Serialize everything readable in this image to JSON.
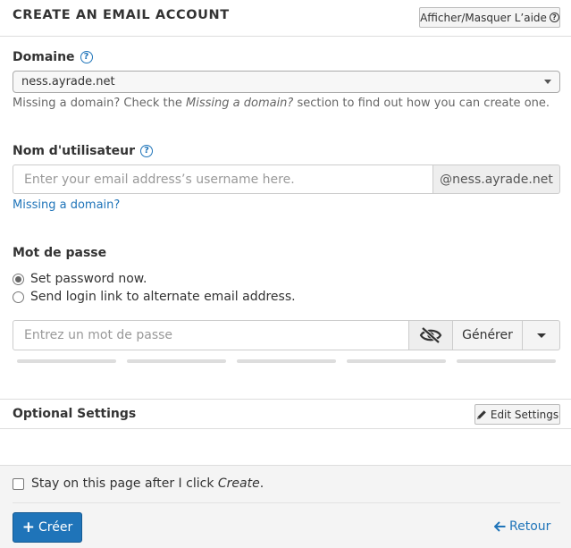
{
  "header": {
    "title": "CREATE AN EMAIL ACCOUNT",
    "help_toggle_label": "Afficher/Masquer L’aide",
    "help_icon": "?"
  },
  "domain": {
    "label": "Domaine",
    "help_icon": "?",
    "selected": "ness.ayrade.net",
    "hint_prefix": "Missing a domain? Check the ",
    "hint_emphasis": "Missing a domain?",
    "hint_suffix": " section to find out how you can create one."
  },
  "username": {
    "label": "Nom d'utilisateur",
    "help_icon": "?",
    "placeholder": "Enter your email address’s username here.",
    "domain_suffix": "@ness.ayrade.net",
    "missing_link": "Missing a domain?"
  },
  "password": {
    "label": "Mot de passe",
    "options": [
      {
        "label": "Set password now.",
        "checked": true
      },
      {
        "label": "Send login link to alternate email address.",
        "checked": false
      }
    ],
    "placeholder": "Entrez un mot de passe",
    "generate_label": "Générer"
  },
  "optional": {
    "title": "Optional Settings",
    "edit_label": "Edit Settings"
  },
  "footer": {
    "stay_prefix": "Stay on this page after I click ",
    "stay_emphasis": "Create",
    "stay_suffix": ".",
    "create_label": "Créer",
    "back_label": "Retour"
  },
  "colors": {
    "accent": "#1f74b9",
    "footer_bg": "#f4f4f4"
  }
}
